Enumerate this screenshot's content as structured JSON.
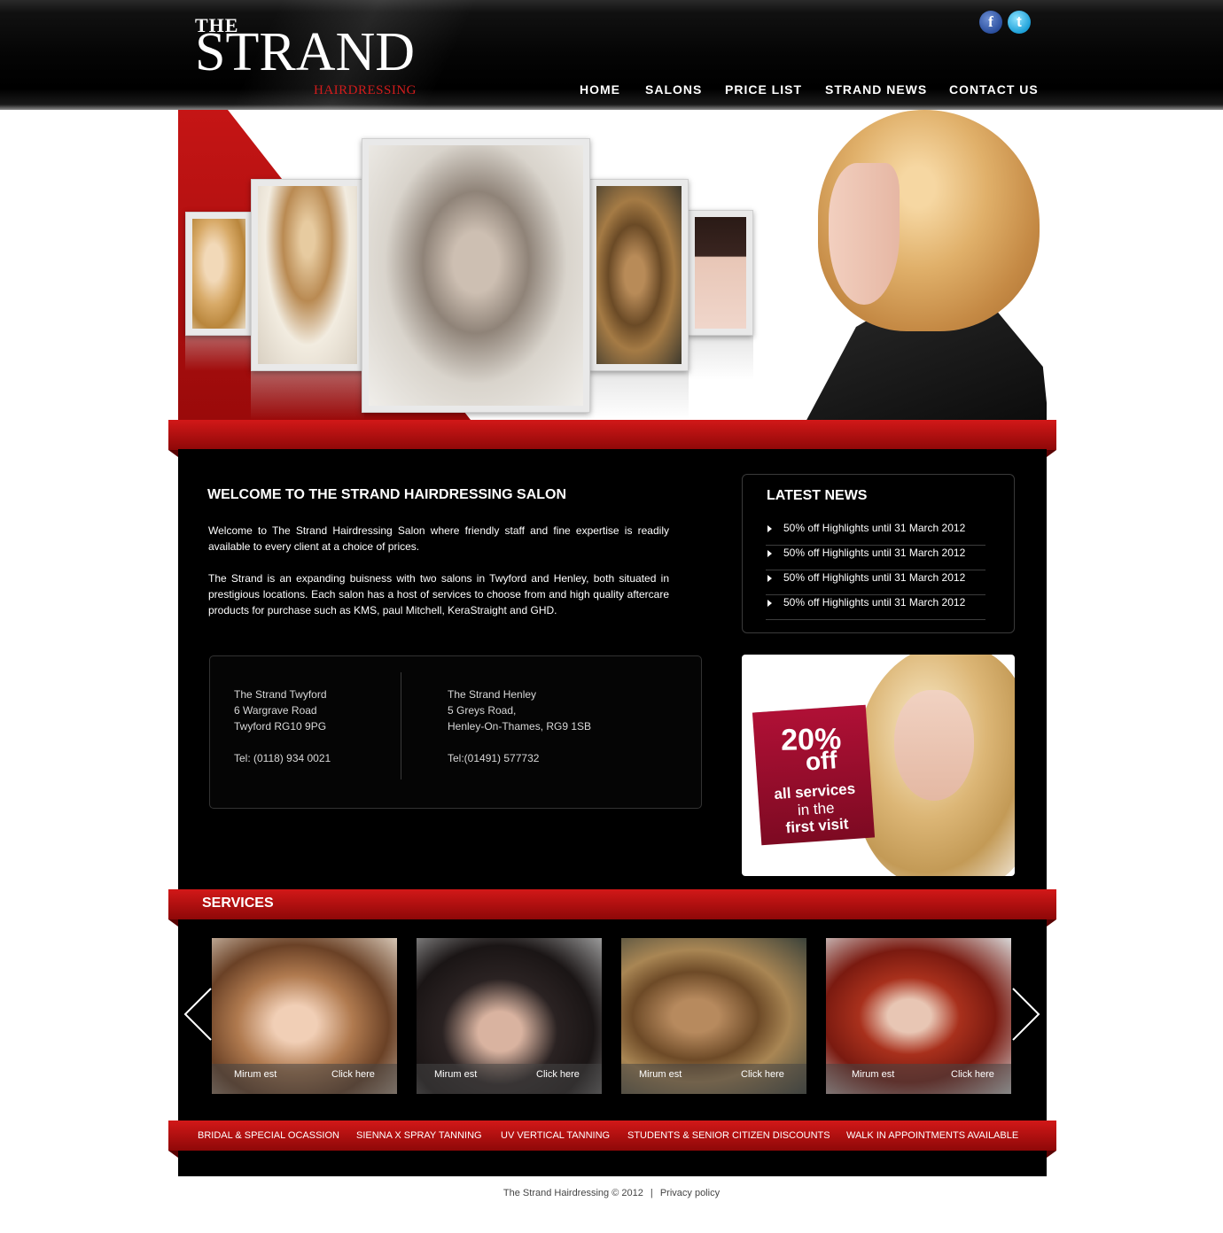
{
  "header": {
    "logo_the": "THE",
    "logo_strand": "STRAND",
    "logo_sub": "HAIRDRESSING",
    "social": {
      "facebook": "f",
      "twitter": "t"
    },
    "nav": [
      "HOME",
      "SALONS",
      "PRICE LIST",
      "STRAND NEWS",
      "CONTACT US"
    ]
  },
  "welcome": {
    "title": "WELCOME TO THE STRAND HAIRDRESSING SALON",
    "p1": "Welcome to The Strand Hairdressing Salon where friendly staff and fine expertise is readily available to every client at a choice of prices.",
    "p2": "The Strand is an expanding buisness with two salons in Twyford and Henley, both situated in prestigious locations. Each salon has a host of services to choose from and high quality aftercare products for purchase such as KMS, paul Mitchell, KeraStraight and GHD."
  },
  "addresses": {
    "twyford": [
      "The Strand Twyford",
      "6 Wargrave Road",
      "Twyford RG10 9PG",
      "Tel: (0118) 934 0021"
    ],
    "henley": [
      "The Strand Henley",
      "5 Greys Road,",
      "Henley-On-Thames, RG9 1SB",
      "Tel:(01491) 577732"
    ]
  },
  "news": {
    "title": "LATEST NEWS",
    "items": [
      "50% off Highlights until 31 March 2012",
      "50% off Highlights until 31 March 2012",
      "50% off Highlights until 31 March 2012",
      "50% off Highlights until 31 March 2012"
    ]
  },
  "promo": {
    "percent": "20%",
    "off": "off",
    "line1": "all services",
    "line2": "in the",
    "line3": "first visit"
  },
  "services": {
    "title": "SERVICES",
    "thumbs": [
      {
        "left": "Mirum est",
        "right": "Click here"
      },
      {
        "left": "Mirum est",
        "right": "Click here"
      },
      {
        "left": "Mirum est",
        "right": "Click here"
      },
      {
        "left": "Mirum est",
        "right": "Click here"
      }
    ]
  },
  "bottom_links": [
    "BRIDAL & SPECIAL OCASSION",
    "SIENNA X SPRAY TANNING",
    "UV VERTICAL TANNING",
    "STUDENTS & SENIOR CITIZEN DISCOUNTS",
    "WALK IN APPOINTMENTS AVAILABLE"
  ],
  "footer": {
    "copyright": "The Strand Hairdressing © 2012",
    "sep": "|",
    "privacy": "Privacy policy"
  },
  "colors": {
    "brand_red": "#c41414",
    "header_black": "#000000",
    "logo_sub_red": "#d21c1c",
    "promo_red": "#b01036"
  }
}
